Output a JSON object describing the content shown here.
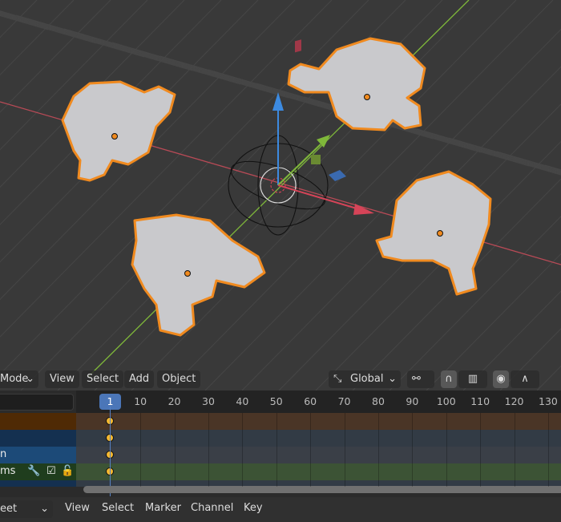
{
  "viewport_header": {
    "mode_label": "Mode",
    "menus": [
      "View",
      "Select",
      "Add",
      "Object"
    ],
    "orientation_label": "Global",
    "icons": [
      "transform-orientation-icon",
      "pivot-link-icon",
      "snap-magnet-icon",
      "snap-target-icon",
      "proportional-edit-icon",
      "falloff-curve-icon"
    ]
  },
  "timeline": {
    "current_frame": "1",
    "ticks": [
      "10",
      "20",
      "30",
      "40",
      "50",
      "60",
      "70",
      "80",
      "90",
      "100",
      "110",
      "120",
      "130"
    ],
    "channels": [
      {
        "label": "",
        "color": "#4f2a05",
        "row_color": "#4a3526"
      },
      {
        "label": "",
        "color": "#143050",
        "row_color": "#323b45"
      },
      {
        "label": "n",
        "color": "#1c4a78",
        "row_color": "#3a3f47"
      },
      {
        "label": "ms",
        "color": "#1f3d1d",
        "row_color": "#3c5335"
      },
      {
        "label": "",
        "color": "#143050",
        "row_color": "#323b45"
      }
    ],
    "keyframes_at": 1
  },
  "bottom_header": {
    "editor_label": "eet",
    "menus": [
      "View",
      "Select",
      "Marker",
      "Channel",
      "Key"
    ]
  },
  "colors": {
    "selection_outline": "#f08a1f",
    "x_axis": "#d64458",
    "y_axis": "#7fb83a",
    "z_axis": "#3c8ae0",
    "keyframe": "#f5b830",
    "current_frame": "#4b76b8"
  }
}
